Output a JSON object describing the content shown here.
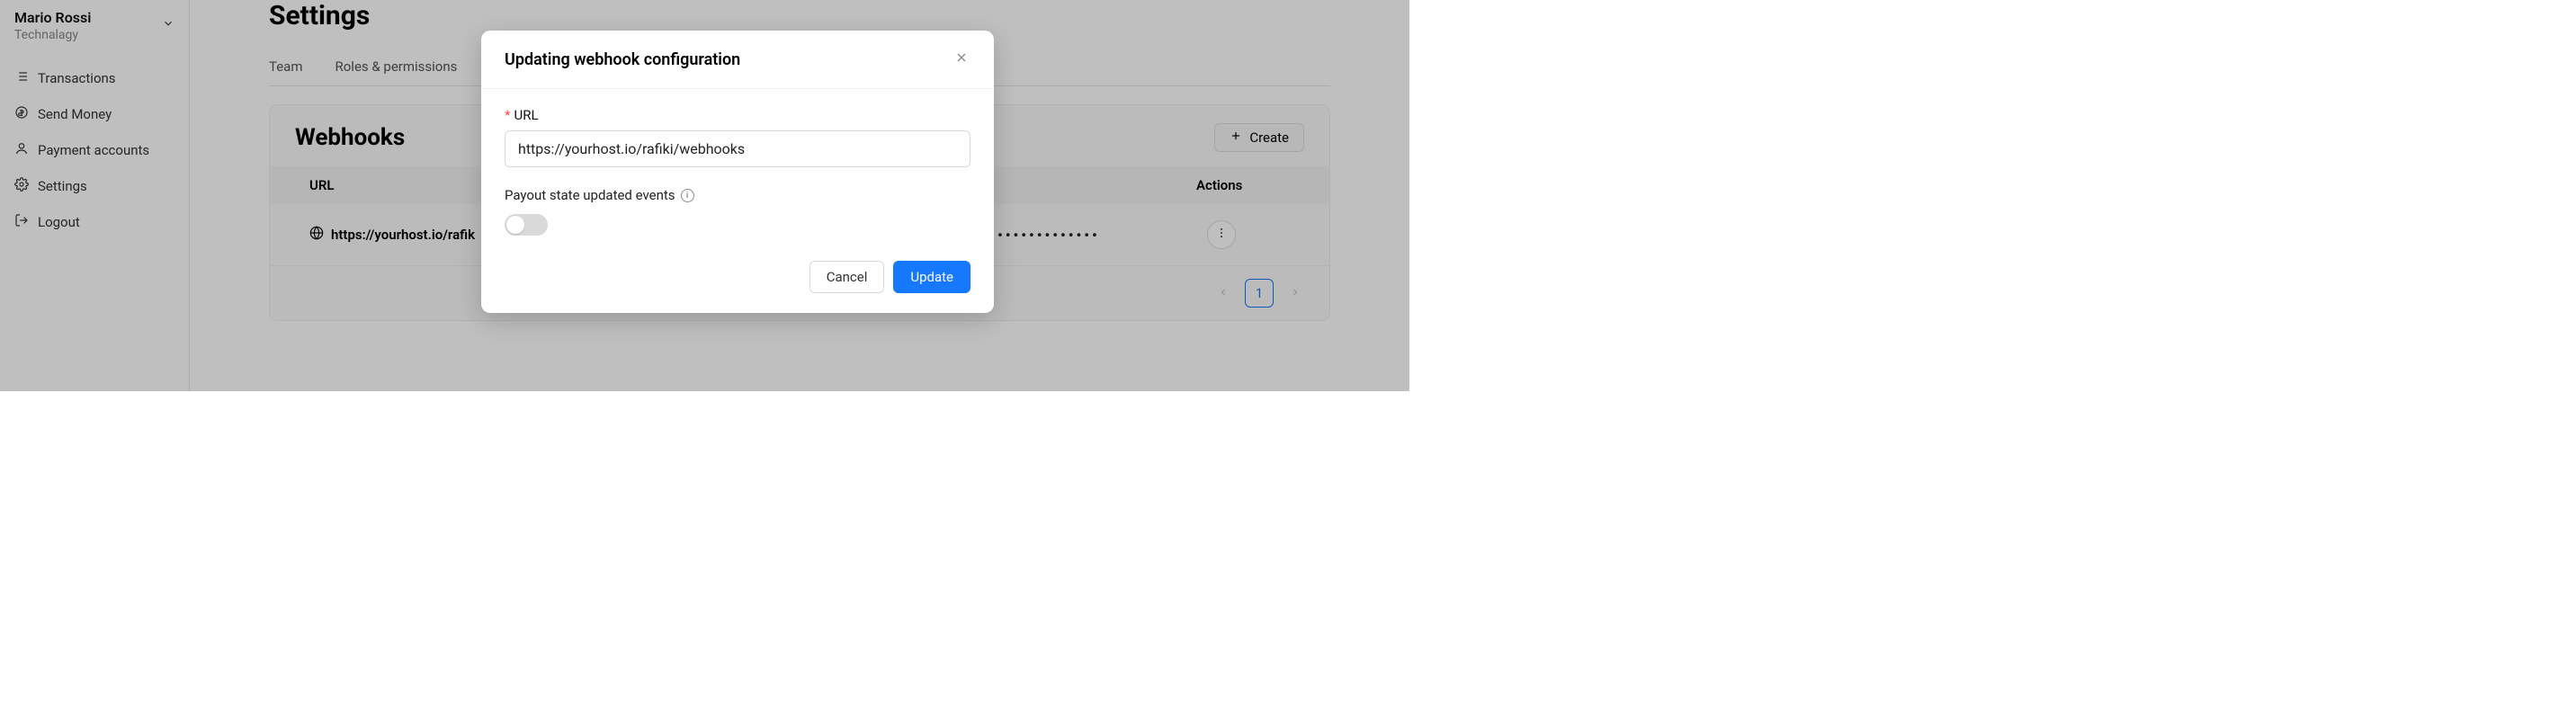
{
  "user": {
    "name": "Mario Rossi",
    "org": "Technalagy"
  },
  "nav": {
    "transactions": "Transactions",
    "send_money": "Send Money",
    "payment_accounts": "Payment accounts",
    "settings": "Settings",
    "logout": "Logout"
  },
  "page": {
    "title": "Settings"
  },
  "tabs": {
    "team": "Team",
    "roles": "Roles & permissions"
  },
  "card": {
    "title": "Webhooks",
    "create": "Create",
    "columns": {
      "url": "URL",
      "actions": "Actions"
    },
    "row": {
      "url": "https://yourhost.io/rafik",
      "masked": "••••••••••••••••••••••••••"
    }
  },
  "pagination": {
    "page1": "1"
  },
  "modal": {
    "title": "Updating webhook configuration",
    "url_label": "URL",
    "url_value": "https://yourhost.io/rafiki/webhooks",
    "payout_label": "Payout state updated events",
    "cancel": "Cancel",
    "update": "Update"
  }
}
